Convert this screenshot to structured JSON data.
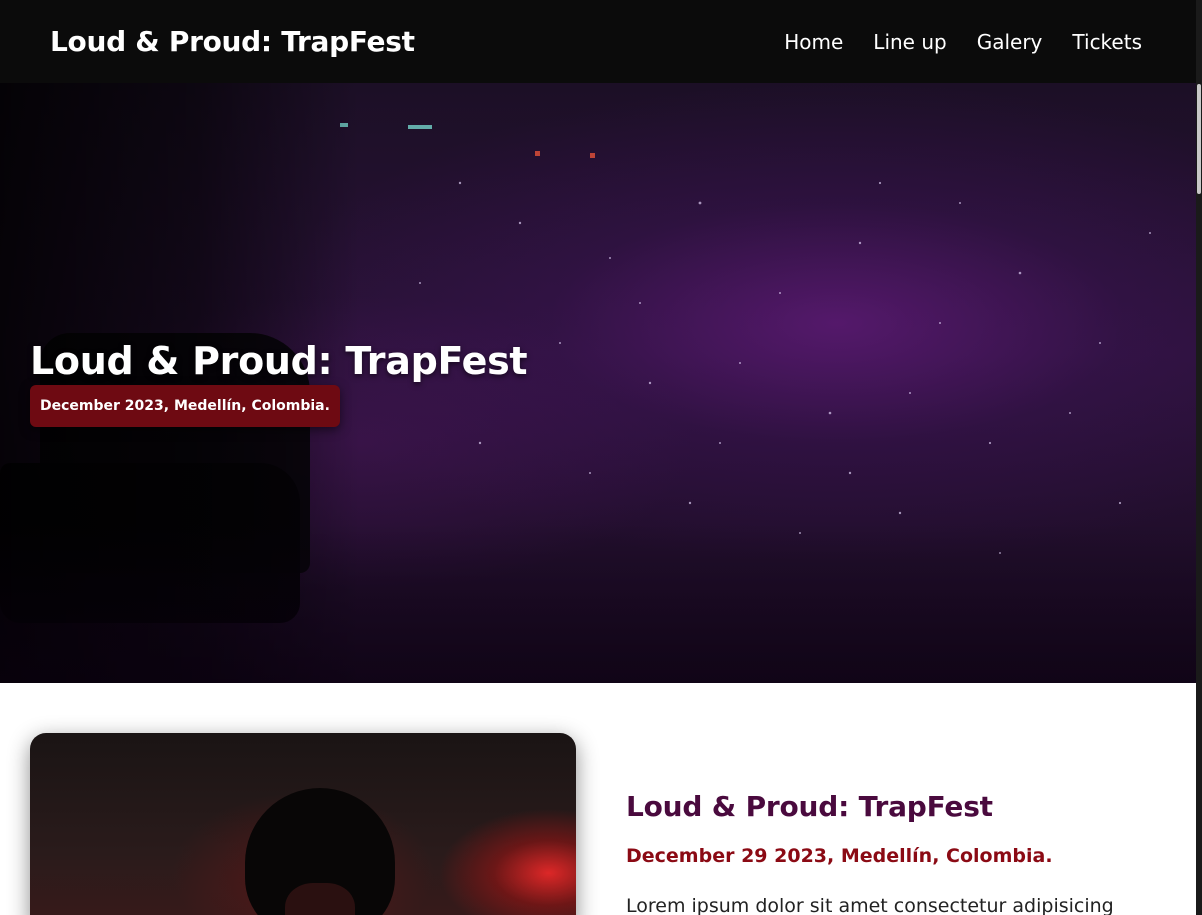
{
  "header": {
    "brand": "Loud & Proud: TrapFest",
    "nav": [
      {
        "label": "Home"
      },
      {
        "label": "Line up"
      },
      {
        "label": "Galery"
      },
      {
        "label": "Tickets"
      }
    ]
  },
  "hero": {
    "title": "Loud & Proud: TrapFest",
    "badge": "December 2023, Medellín, Colombia."
  },
  "about": {
    "title": "Loud & Proud: TrapFest",
    "date": "December 29 2023, Medellín, Colombia.",
    "body": "Lorem ipsum dolor sit amet consectetur adipisicing"
  },
  "colors": {
    "header_bg": "#0b0b0b",
    "badge_bg": "#6e0a12",
    "about_title": "#4a0a3e",
    "about_date": "#8b0a14"
  }
}
